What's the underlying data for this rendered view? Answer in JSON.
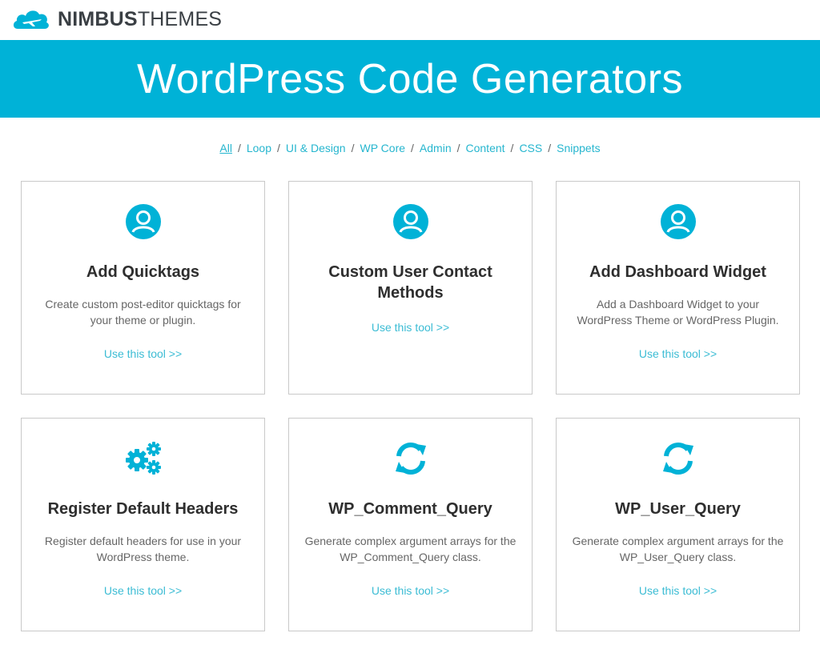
{
  "brand": {
    "bold": "NIMBUS",
    "light": "THEMES"
  },
  "banner": {
    "title": "WordPress Code Generators"
  },
  "filters": [
    "All",
    "Loop",
    "UI & Design",
    "WP Core",
    "Admin",
    "Content",
    "CSS",
    "Snippets"
  ],
  "active_filter": "All",
  "colors": {
    "accent": "#00b2d7",
    "link": "#26b6cf",
    "text": "#2e2e2e"
  },
  "cards": [
    {
      "icon": "user-icon",
      "title": "Add Quicktags",
      "desc": "Create custom post-editor quicktags for your theme or plugin.",
      "link": "Use this tool >>"
    },
    {
      "icon": "user-icon",
      "title": "Custom User Contact Methods",
      "desc": "",
      "link": "Use this tool >>"
    },
    {
      "icon": "user-icon",
      "title": "Add Dashboard Widget",
      "desc": "Add a Dashboard Widget to your WordPress Theme or WordPress Plugin.",
      "link": "Use this tool >>"
    },
    {
      "icon": "gears-icon",
      "title": "Register Default Headers",
      "desc": "Register default headers for use in your WordPress theme.",
      "link": "Use this tool >>"
    },
    {
      "icon": "refresh-icon",
      "title": "WP_Comment_Query",
      "desc": "Generate complex argument arrays for the WP_Comment_Query class.",
      "link": "Use this tool >>"
    },
    {
      "icon": "refresh-icon",
      "title": "WP_User_Query",
      "desc": "Generate complex argument arrays for the WP_User_Query class.",
      "link": "Use this tool >>"
    }
  ]
}
